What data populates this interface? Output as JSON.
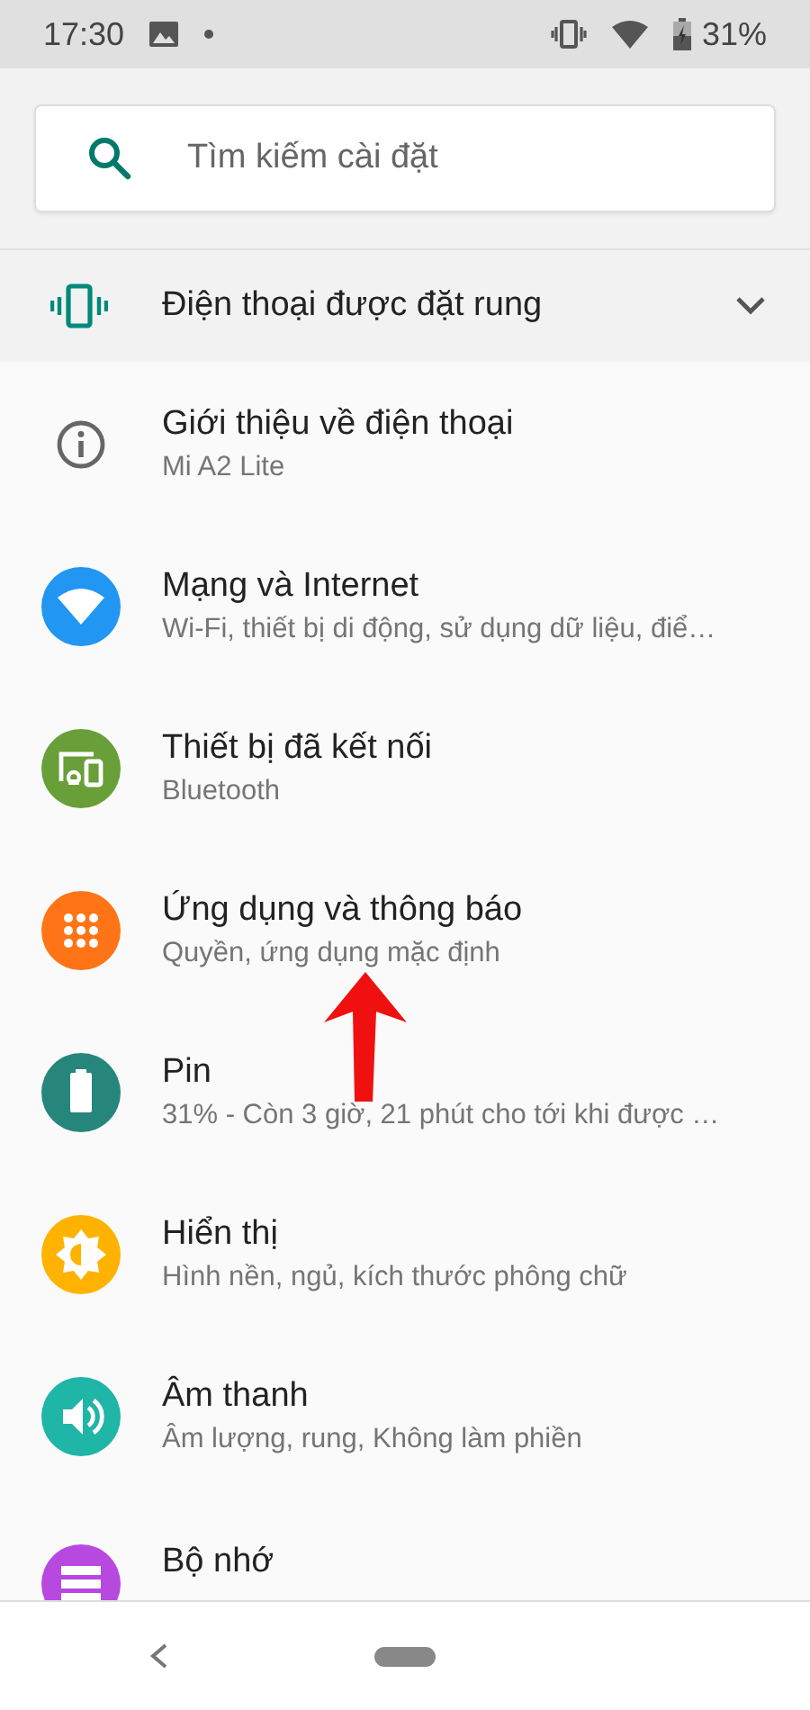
{
  "status_bar": {
    "time": "17:30",
    "battery": "31%"
  },
  "search": {
    "placeholder": "Tìm kiếm cài đặt"
  },
  "condition": {
    "title": "Điện thoại được đặt rung",
    "expanded": false
  },
  "items": [
    {
      "kind": "info",
      "title": "Giới thiệu về điện thoại",
      "subtitle": "Mi A2 Lite"
    },
    {
      "kind": "wifi",
      "color": "#2196f3",
      "title": "Mạng và Internet",
      "subtitle": "Wi-Fi, thiết bị di động, sử dụng dữ liệu, điể…"
    },
    {
      "kind": "devices",
      "color": "#689f38",
      "title": "Thiết bị đã kết nối",
      "subtitle": "Bluetooth"
    },
    {
      "kind": "apps",
      "color": "#ff7416",
      "title": "Ứng dụng và thông báo",
      "subtitle": "Quyền, ứng dụng mặc định"
    },
    {
      "kind": "battery",
      "color": "#26867b",
      "title": "Pin",
      "subtitle": "31% - Còn 3 giờ, 21 phút cho tới khi được …"
    },
    {
      "kind": "display",
      "color": "#ffb300",
      "title": "Hiển thị",
      "subtitle": "Hình nền, ngủ, kích thước phông chữ"
    },
    {
      "kind": "sound",
      "color": "#1fb5a7",
      "title": "Âm thanh",
      "subtitle": "Âm lượng, rung, Không làm phiền"
    },
    {
      "kind": "storage",
      "color": "#b849e0",
      "title": "Bộ nhớ"
    }
  ]
}
